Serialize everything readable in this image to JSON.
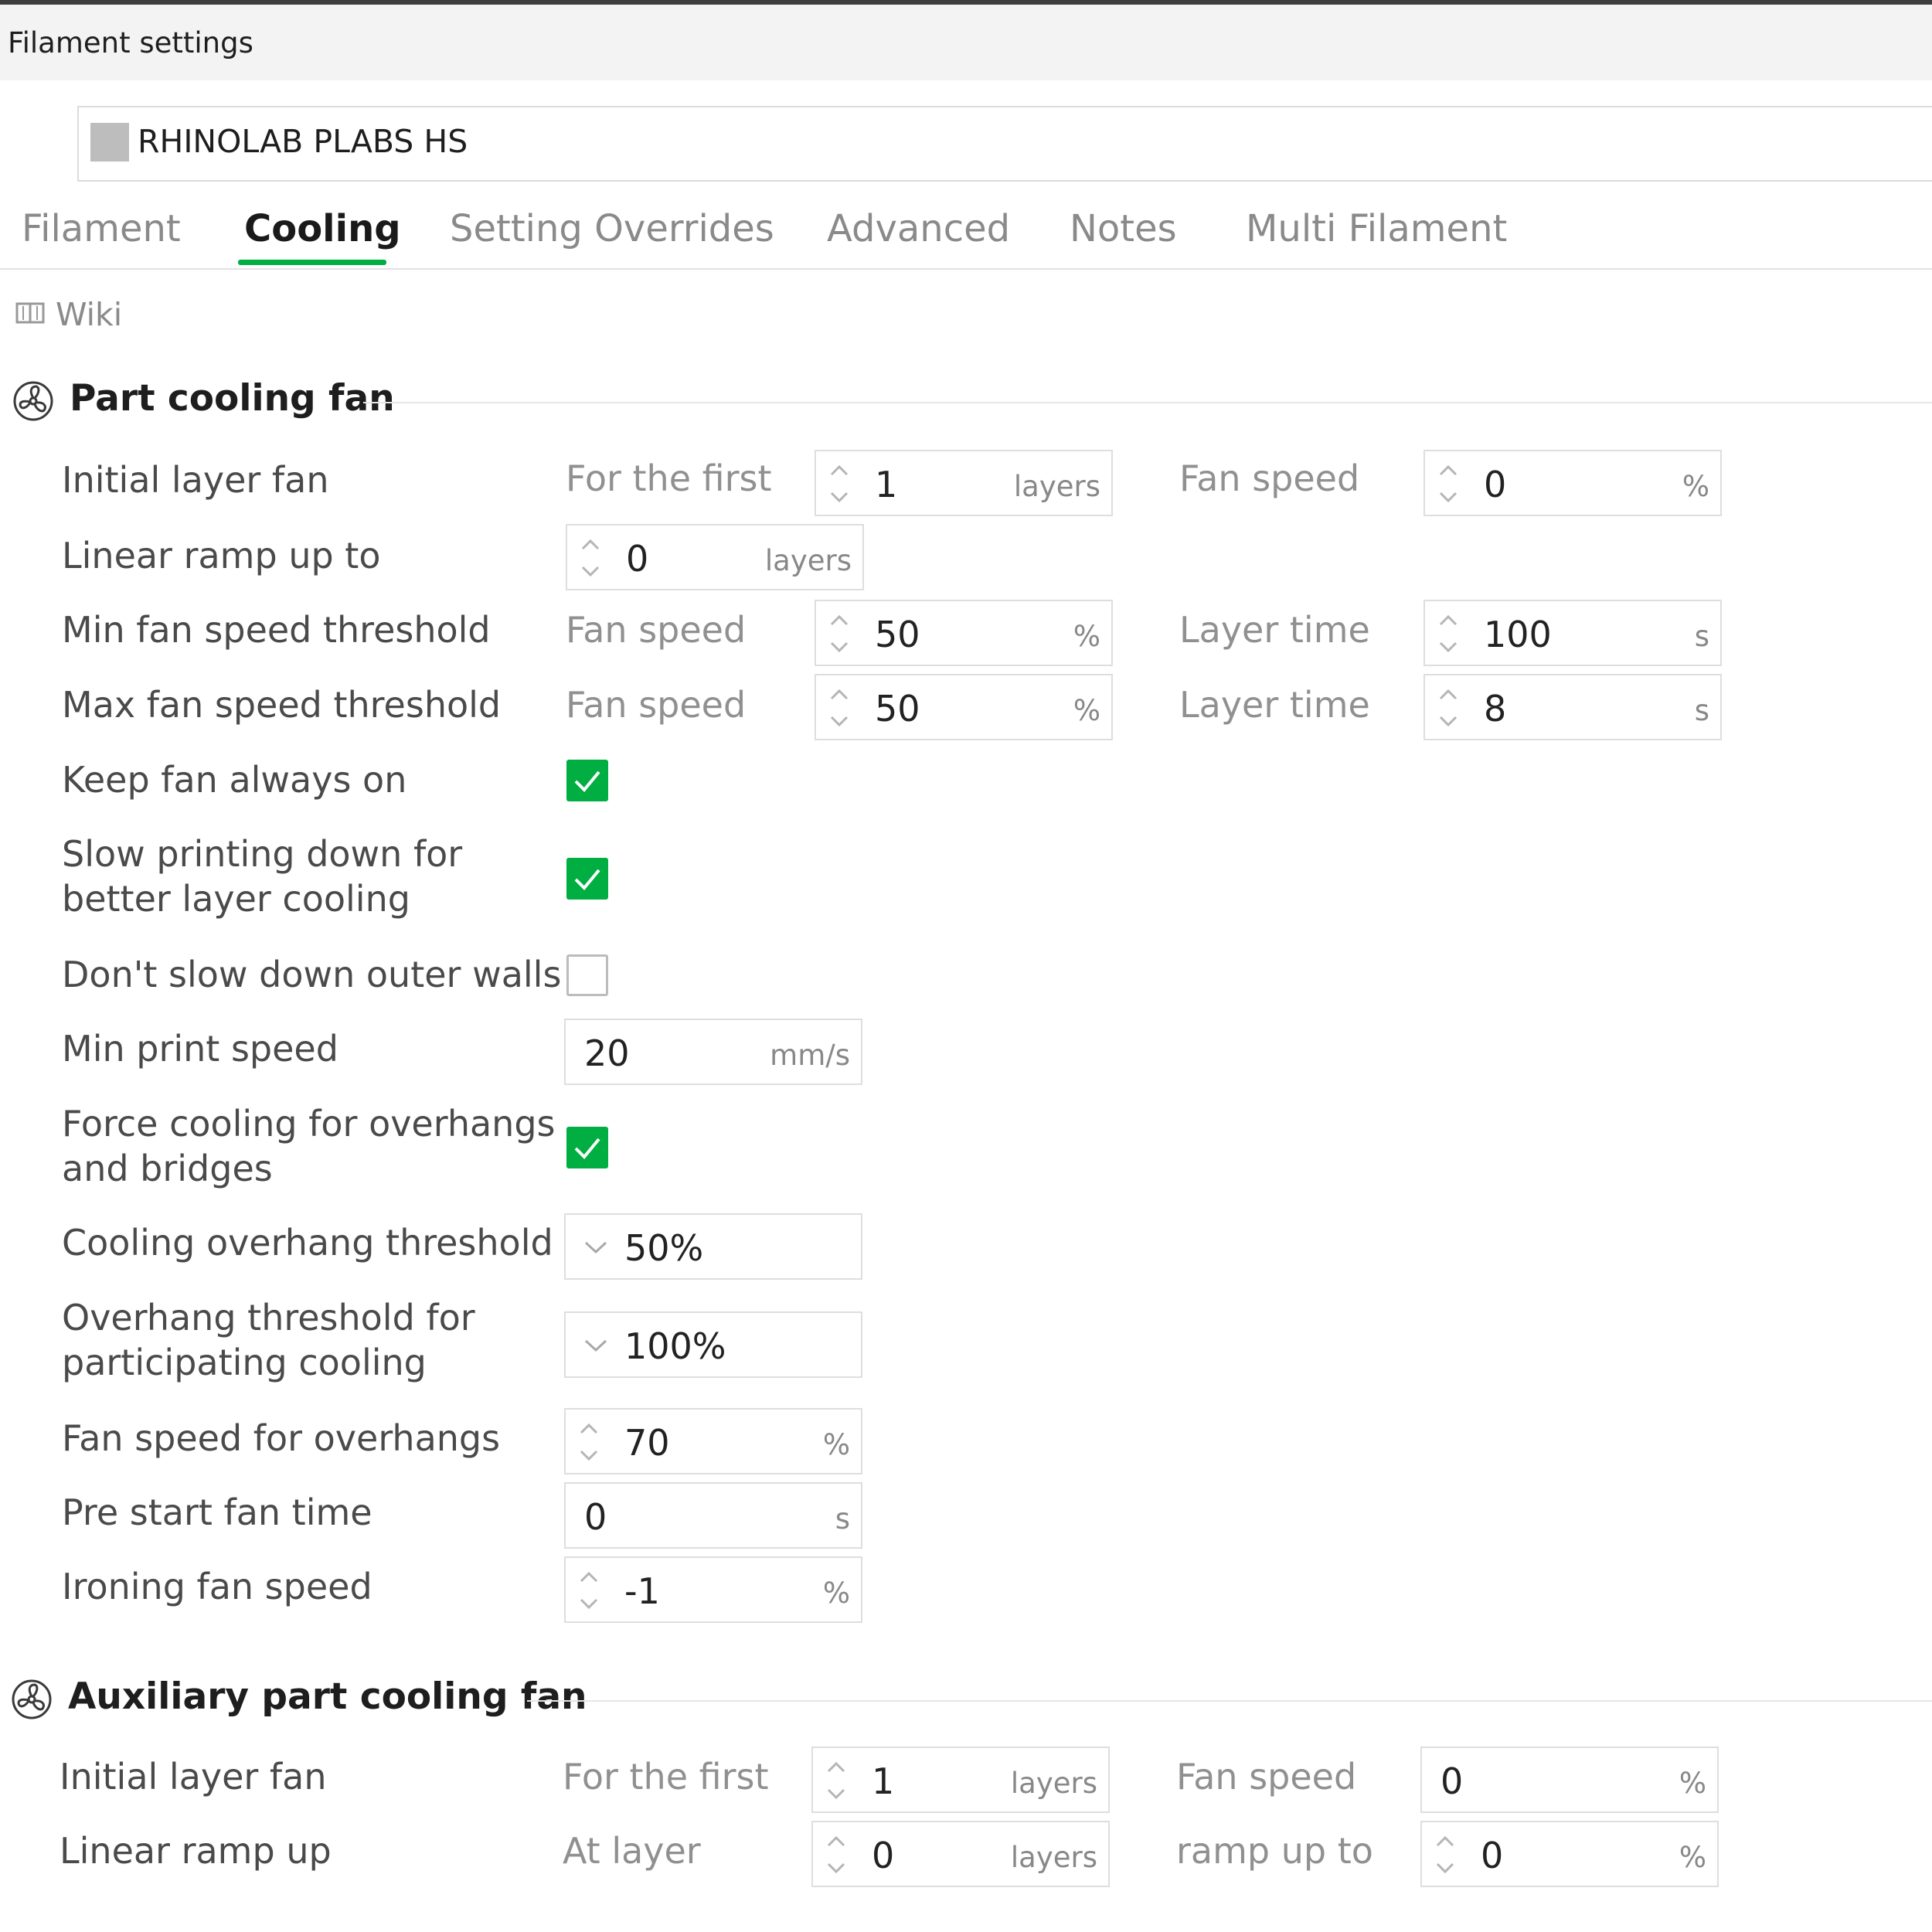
{
  "window": {
    "title": "Filament settings"
  },
  "preset": {
    "name": "RHINOLAB PLABS HS"
  },
  "tabs": [
    {
      "label": "Filament"
    },
    {
      "label": "Cooling"
    },
    {
      "label": "Setting Overrides"
    },
    {
      "label": "Advanced"
    },
    {
      "label": "Notes"
    },
    {
      "label": "Multi Filament"
    }
  ],
  "active_tab": "Cooling",
  "wiki": {
    "label": "Wiki"
  },
  "part_cooling": {
    "title": "Part cooling fan",
    "initial_layer_fan": {
      "label": "Initial layer fan",
      "first_label": "For the first",
      "first_value": "1",
      "first_unit": "layers",
      "speed_label": "Fan speed",
      "speed_value": "0",
      "speed_unit": "%"
    },
    "linear_ramp": {
      "label": "Linear ramp up to",
      "value": "0",
      "unit": "layers"
    },
    "min_fan_threshold": {
      "label": "Min fan speed threshold",
      "speed_label": "Fan speed",
      "speed_value": "50",
      "speed_unit": "%",
      "time_label": "Layer time",
      "time_value": "100",
      "time_unit": "s"
    },
    "max_fan_threshold": {
      "label": "Max fan speed threshold",
      "speed_label": "Fan speed",
      "speed_value": "50",
      "speed_unit": "%",
      "time_label": "Layer time",
      "time_value": "8",
      "time_unit": "s"
    },
    "keep_fan_on": {
      "label": "Keep fan always on",
      "checked": true
    },
    "slow_printing": {
      "label_line1": "Slow printing down for",
      "label_line2": "better layer cooling",
      "checked": true
    },
    "dont_slow_outer": {
      "label": "Don't slow down outer walls",
      "checked": false
    },
    "min_print_speed": {
      "label": "Min print speed",
      "value": "20",
      "unit": "mm/s"
    },
    "force_cooling": {
      "label_line1": "Force cooling for overhangs",
      "label_line2": "and bridges",
      "checked": true
    },
    "overhang_threshold": {
      "label": "Cooling overhang threshold",
      "value": "50%"
    },
    "participating_threshold": {
      "label_line1": "Overhang threshold for",
      "label_line2": "participating cooling",
      "value": "100%"
    },
    "fan_speed_overhangs": {
      "label": "Fan speed for overhangs",
      "value": "70",
      "unit": "%"
    },
    "pre_start_fan": {
      "label": "Pre start fan time",
      "value": "0",
      "unit": "s"
    },
    "ironing_fan": {
      "label": "Ironing fan speed",
      "value": "-1",
      "unit": "%"
    }
  },
  "aux_cooling": {
    "title": "Auxiliary part cooling fan",
    "initial_layer_fan": {
      "label": "Initial layer fan",
      "first_label": "For the first",
      "first_value": "1",
      "first_unit": "layers",
      "speed_label": "Fan speed",
      "speed_value": "0",
      "speed_unit": "%"
    },
    "linear_ramp": {
      "label": "Linear ramp up",
      "at_label": "At layer",
      "at_value": "0",
      "at_unit": "layers",
      "ramp_label": "ramp up to",
      "ramp_value": "0",
      "ramp_unit": "%"
    }
  },
  "colors": {
    "accent": "#00ae42",
    "text": "#4a4a4a",
    "muted": "#909090"
  }
}
